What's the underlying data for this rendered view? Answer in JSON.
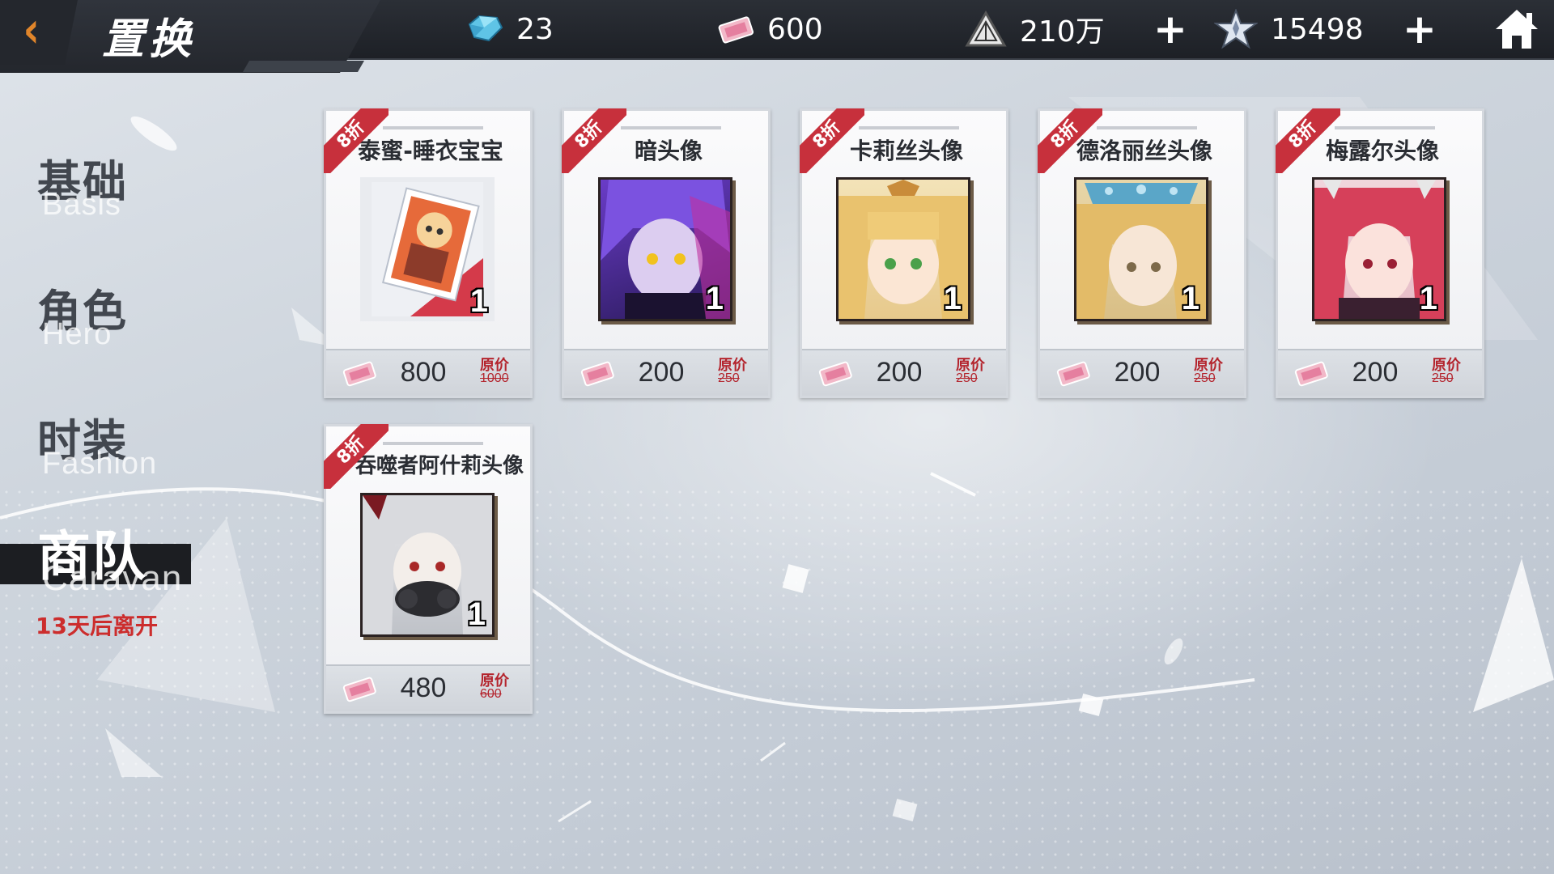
{
  "header": {
    "back_icon": "back-arrow-icon",
    "title": "置换"
  },
  "currencies": [
    {
      "icon": "crystal-icon",
      "value": "23"
    },
    {
      "icon": "ticket-icon",
      "value": "600"
    },
    {
      "icon": "triangle-emblem-icon",
      "value": "210万"
    },
    {
      "icon": "star-emblem-icon",
      "value": "15498"
    }
  ],
  "nav": {
    "items": [
      {
        "zh": "基础",
        "en": "Basis",
        "active": false
      },
      {
        "zh": "角色",
        "en": "Hero",
        "active": false
      },
      {
        "zh": "时装",
        "en": "Fashion",
        "active": false
      },
      {
        "zh": "商队",
        "en": "Caravan",
        "active": true
      }
    ],
    "leave_notice": "13天后离开"
  },
  "shop": {
    "original_price_label": "原价",
    "items": [
      {
        "discount": "8折",
        "name": "泰蜜-睡衣宝宝",
        "quantity": "1",
        "price": "800",
        "original_price": "1000"
      },
      {
        "discount": "8折",
        "name": "暗头像",
        "quantity": "1",
        "price": "200",
        "original_price": "250"
      },
      {
        "discount": "8折",
        "name": "卡莉丝头像",
        "quantity": "1",
        "price": "200",
        "original_price": "250"
      },
      {
        "discount": "8折",
        "name": "德洛丽丝头像",
        "quantity": "1",
        "price": "200",
        "original_price": "250"
      },
      {
        "discount": "8折",
        "name": "梅露尔头像",
        "quantity": "1",
        "price": "200",
        "original_price": "250"
      },
      {
        "discount": "8折",
        "name": "吞噬者阿什莉头像",
        "quantity": "1",
        "price": "480",
        "original_price": "600"
      }
    ]
  },
  "colors": {
    "accent_orange": "#e0852a",
    "discount_red": "#c7303c",
    "leave_red": "#cc2d2d",
    "topbar": "#1d2026"
  }
}
